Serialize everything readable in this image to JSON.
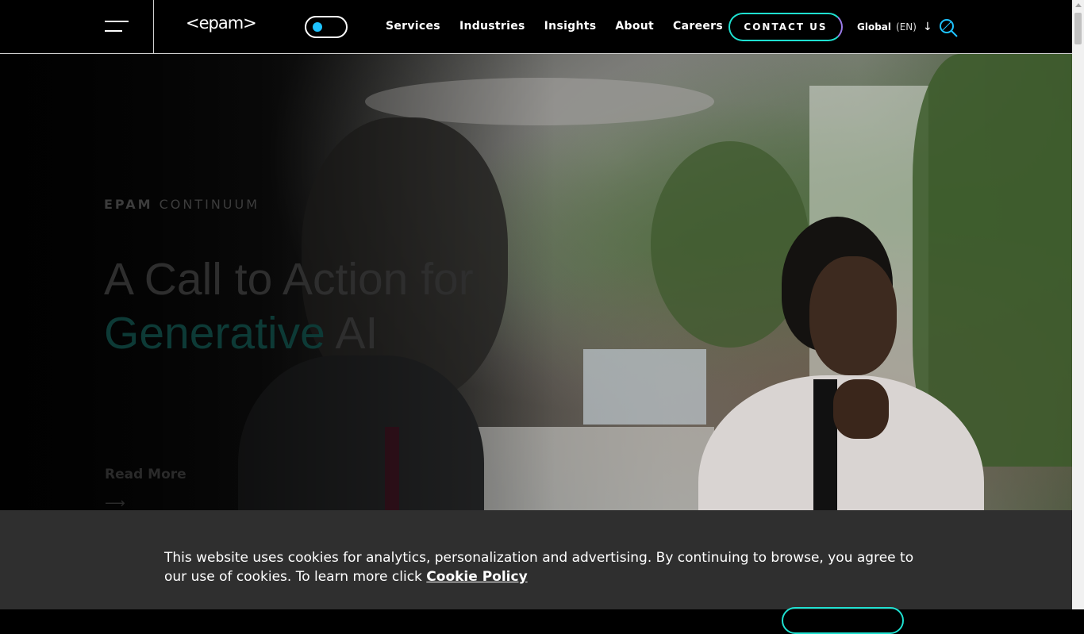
{
  "header": {
    "logo_text": "<epam>",
    "nav": [
      {
        "label": "Services"
      },
      {
        "label": "Industries"
      },
      {
        "label": "Insights"
      },
      {
        "label": "About"
      },
      {
        "label": "Careers"
      }
    ],
    "contact_label": "CONTACT US",
    "language": {
      "region": "Global",
      "code": "(EN)"
    },
    "toggle_accent": "#1ec3ff"
  },
  "hero": {
    "eyebrow_brand": "EPAM",
    "eyebrow_rest": "CONTINUUM",
    "headline_line1": "A Call to Action for",
    "headline_accent": "Generative",
    "headline_tail": "AI",
    "read_more": "Read More",
    "arrow": "⟶"
  },
  "cookie": {
    "text": "This website uses cookies for analytics, personalization and advertising. By continuing to browse, you agree to our use of cookies. To learn more click",
    "link": "Cookie Policy"
  },
  "colors": {
    "accent_teal": "#1ee0d0",
    "accent_purple": "#9a7be8",
    "banner_bg": "#2f2f2f"
  }
}
